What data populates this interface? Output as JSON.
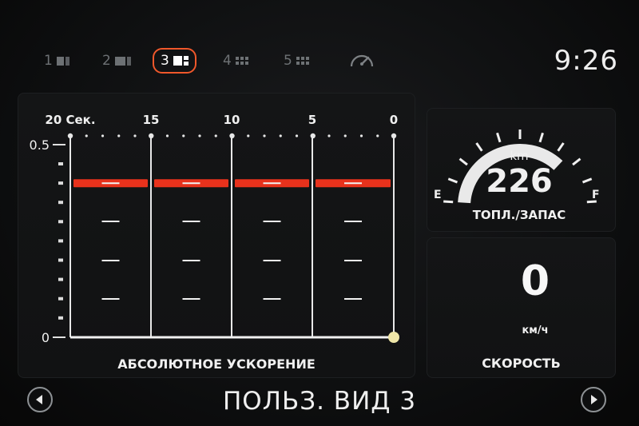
{
  "tabs": [
    {
      "label": "1",
      "icon": "layout-1-icon"
    },
    {
      "label": "2",
      "icon": "layout-2-icon"
    },
    {
      "label": "3",
      "icon": "layout-3-icon",
      "active": true
    },
    {
      "label": "4",
      "icon": "layout-4-icon"
    },
    {
      "label": "5",
      "icon": "layout-5-icon"
    },
    {
      "label": "",
      "icon": "gauge-icon"
    }
  ],
  "clock": "9:26",
  "acceleration": {
    "title": "АБСОЛЮТНОЕ УСКОРЕНИЕ",
    "time_labels": [
      "20 Сек.",
      "15",
      "10",
      "5",
      "0"
    ],
    "y_labels": [
      "0.5",
      "0"
    ],
    "level_fraction": 0.8
  },
  "fuel": {
    "unit": "km",
    "value": "226",
    "empty_label": "E",
    "full_label": "F",
    "title": "ТОПЛ./ЗАПАС",
    "level_fraction": 0.75
  },
  "speed": {
    "value": "0",
    "unit": "км/ч",
    "title": "СКОРОСТЬ"
  },
  "footer": {
    "title": "ПОЛЬЗ. ВИД 3"
  },
  "colors": {
    "accent": "#f0582b",
    "level_bar": "#e8321c",
    "dim": "#6d7174"
  }
}
